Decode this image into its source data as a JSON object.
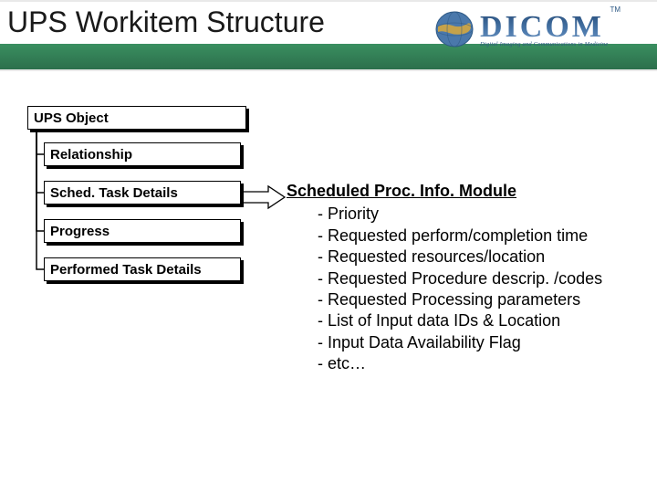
{
  "banner": {
    "title": "UPS Workitem Structure"
  },
  "logo": {
    "word": "DICOM",
    "tm": "TM",
    "tagline": "Digital Imaging and Communications in Medicine"
  },
  "tree": {
    "parent": "UPS Object",
    "children": [
      "Relationship",
      "Sched. Task Details",
      "Progress",
      "Performed Task Details"
    ]
  },
  "module": {
    "title": "Scheduled Proc. Info. Module",
    "items": [
      "- Priority",
      "- Requested perform/completion time",
      "- Requested resources/location",
      "- Requested Procedure descrip. /codes",
      "- Requested Processing parameters",
      "- List of Input data IDs & Location",
      "- Input Data Availability Flag",
      "- etc…"
    ]
  }
}
